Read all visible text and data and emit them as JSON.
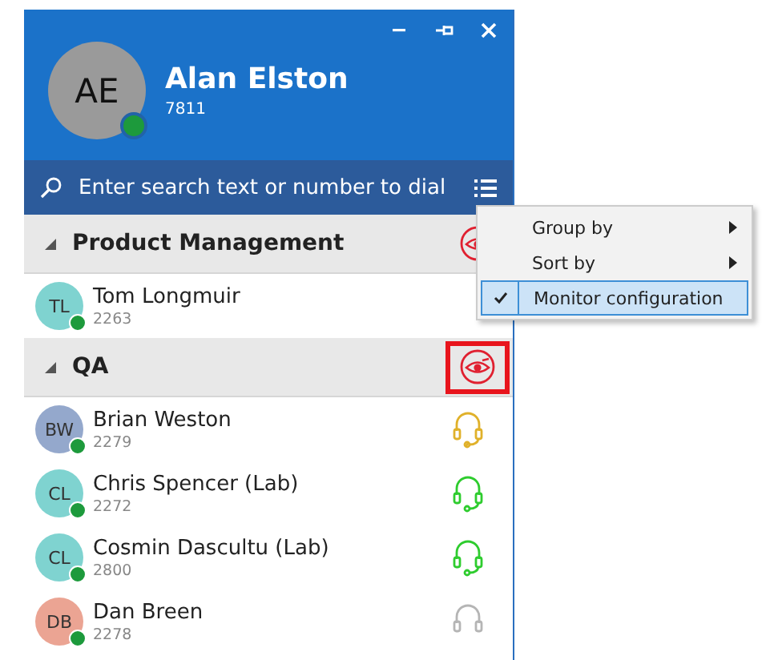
{
  "user": {
    "initials": "AE",
    "name": "Alan Elston",
    "extension": "7811"
  },
  "search": {
    "placeholder": "Enter search text or number to dial"
  },
  "groups": [
    {
      "name": "Product Management",
      "expanded": true,
      "monitored": true,
      "highlighted": false,
      "contacts": [
        {
          "initials": "TL",
          "name": "Tom Longmuir",
          "extension": "2263",
          "color": "#7fd3d0"
        }
      ]
    },
    {
      "name": "QA",
      "expanded": true,
      "monitored": true,
      "highlighted": true,
      "contacts": [
        {
          "initials": "BW",
          "name": "Brian Weston",
          "extension": "2279",
          "color": "#94a8cc",
          "kind": "busy"
        },
        {
          "initials": "CL",
          "name": "Chris Spencer (Lab)",
          "extension": "2272",
          "color": "#7fd3d0",
          "kind": "available"
        },
        {
          "initials": "CL",
          "name": "Cosmin Dascultu (Lab)",
          "extension": "2800",
          "color": "#7fd3d0",
          "kind": "available"
        },
        {
          "initials": "DB",
          "name": "Dan Breen",
          "extension": "2278",
          "color": "#eba493",
          "kind": "offline"
        }
      ]
    }
  ],
  "menu": [
    {
      "label": "Group by",
      "submenu": true,
      "checked": false,
      "selected": false
    },
    {
      "label": "Sort by",
      "submenu": true,
      "checked": false,
      "selected": false
    },
    {
      "label": "Monitor configuration",
      "submenu": false,
      "checked": true,
      "selected": true
    }
  ]
}
